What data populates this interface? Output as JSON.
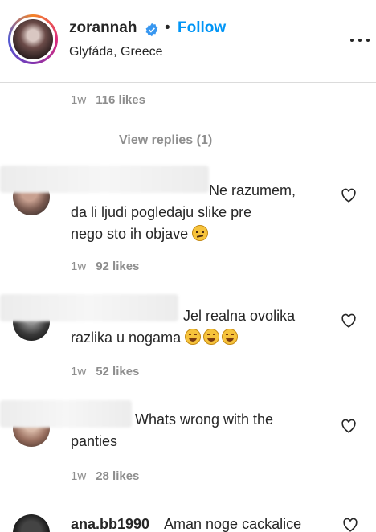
{
  "post": {
    "username": "zorannah",
    "follow_label": "Follow",
    "separator": "•",
    "location": "Glyfáda, Greece"
  },
  "top_comment_meta": {
    "time": "1w",
    "likes": "116 likes"
  },
  "view_replies": "View replies (1)",
  "comments": [
    {
      "text": "Ne razumem,\nda li ljudi pogledaju slike pre\nnego sto ih objave",
      "emoji": [
        "confused-face-emoji"
      ],
      "time": "1w",
      "likes": "92 likes"
    },
    {
      "text": "Jel realna ovolika\nrazlika u nogama",
      "emoji": [
        "tears-of-joy-emoji",
        "tears-of-joy-emoji",
        "tears-of-joy-emoji"
      ],
      "time": "1w",
      "likes": "52 likes"
    },
    {
      "text": "Whats wrong with the\npanties",
      "emoji": [],
      "time": "1w",
      "likes": "28 likes"
    }
  ],
  "last_comment": {
    "username": "ana.bb1990",
    "text": "Aman noge cackalice"
  },
  "colors": {
    "follow": "#0095f6",
    "muted": "#8e8e8e",
    "text": "#262626"
  }
}
